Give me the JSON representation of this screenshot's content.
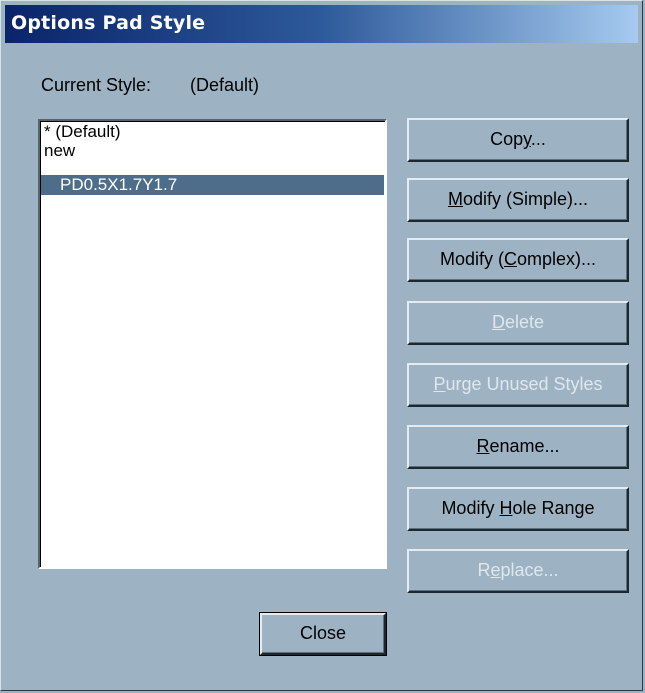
{
  "window": {
    "title": "Options Pad Style"
  },
  "current_style": {
    "label": "Current Style:",
    "value": "(Default)"
  },
  "styles_list": {
    "items": [
      {
        "label": "* (Default)",
        "selected": false
      },
      {
        "label": "new",
        "selected": false
      },
      {
        "label": "PD0.5X1.7Y1.7",
        "selected": true
      }
    ]
  },
  "buttons": {
    "copy": {
      "pre": "Cop",
      "key": "y",
      "post": "...",
      "enabled": true
    },
    "modify_simple": {
      "pre": "",
      "key": "M",
      "post": "odify (Simple)...",
      "enabled": true
    },
    "modify_complex": {
      "pre": "Modify (",
      "key": "C",
      "post": "omplex)...",
      "enabled": true
    },
    "delete": {
      "pre": "",
      "key": "D",
      "post": "elete",
      "enabled": false
    },
    "purge": {
      "pre": "",
      "key": "P",
      "post": "urge Unused Styles",
      "enabled": false
    },
    "rename": {
      "pre": "",
      "key": "R",
      "post": "ename...",
      "enabled": true
    },
    "modify_hole_range": {
      "pre": "Modify ",
      "key": "H",
      "post": "ole Range",
      "enabled": true
    },
    "replace": {
      "pre": "R",
      "key": "e",
      "post": "place...",
      "enabled": false
    },
    "close": {
      "label": "Close"
    }
  },
  "colors": {
    "dialog_bg": "#9db3c3",
    "selection_bg": "#4d6d8a",
    "title_bar_start": "#0a246a"
  }
}
